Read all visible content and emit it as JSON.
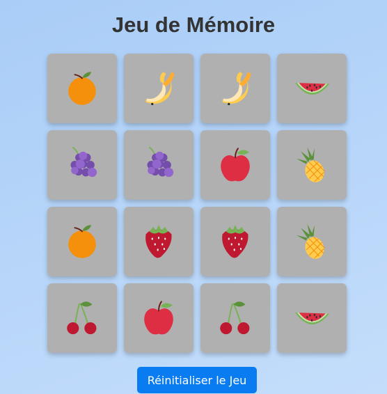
{
  "game": {
    "title": "Jeu de Mémoire",
    "reset_label": "Réinitialiser le Jeu",
    "cards": [
      {
        "fruit": "orange",
        "icon": "orange-icon"
      },
      {
        "fruit": "banana",
        "icon": "banana-icon"
      },
      {
        "fruit": "banana",
        "icon": "banana-icon"
      },
      {
        "fruit": "watermelon",
        "icon": "watermelon-icon"
      },
      {
        "fruit": "grapes",
        "icon": "grapes-icon"
      },
      {
        "fruit": "grapes",
        "icon": "grapes-icon"
      },
      {
        "fruit": "apple",
        "icon": "apple-icon"
      },
      {
        "fruit": "pineapple",
        "icon": "pineapple-icon"
      },
      {
        "fruit": "orange",
        "icon": "orange-icon"
      },
      {
        "fruit": "strawberry",
        "icon": "strawberry-icon"
      },
      {
        "fruit": "strawberry",
        "icon": "strawberry-icon"
      },
      {
        "fruit": "pineapple",
        "icon": "pineapple-icon"
      },
      {
        "fruit": "cherry",
        "icon": "cherry-icon"
      },
      {
        "fruit": "apple",
        "icon": "apple-icon"
      },
      {
        "fruit": "cherry",
        "icon": "cherry-icon"
      },
      {
        "fruit": "watermelon",
        "icon": "watermelon-icon"
      }
    ],
    "colors": {
      "card_back": "#b0b0b0",
      "button": "#0a7cf2",
      "title": "#333333"
    }
  }
}
